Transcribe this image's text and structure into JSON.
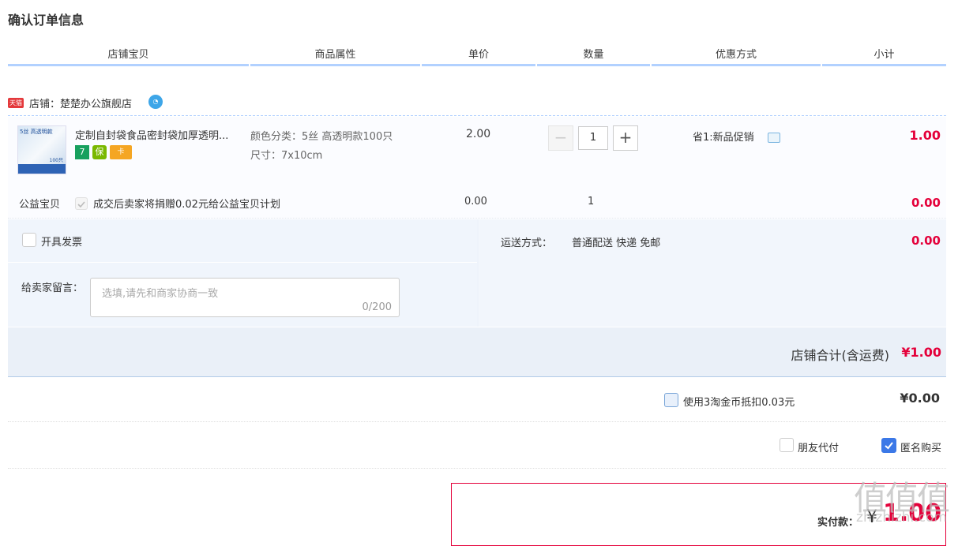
{
  "page_title": "确认订单信息",
  "columns": [
    "店铺宝贝",
    "商品属性",
    "单价",
    "数量",
    "优惠方式",
    "小计"
  ],
  "shop": {
    "badge_text": "天猫",
    "label": "店铺：楚楚办公旗舰店",
    "wangwang_icon": "wangwang-chat-icon"
  },
  "item": {
    "thumb_top_text": "5丝 高透明款",
    "thumb_count_text": "100只",
    "name": "定制自封袋食品密封袋加厚透明...",
    "service_badges": [
      "7",
      "保",
      "卡"
    ],
    "attr_color": "颜色分类：5丝 高透明款100只",
    "attr_size": "尺寸：7x10cm",
    "unit_price": "2.00",
    "quantity": "1",
    "minus": "−",
    "plus": "+",
    "promo": "省1:新品促销",
    "subtotal": "1.00"
  },
  "charity": {
    "label": "公益宝贝",
    "text": "成交后卖家将捐赠0.02元给公益宝贝计划",
    "price": "0.00",
    "quantity": "1",
    "subtotal": "0.00"
  },
  "options": {
    "invoice_label": "开具发票",
    "message_label": "给卖家留言：",
    "message_placeholder": "选填,请先和商家协商一致",
    "message_counter": "0/200",
    "shipping_label": "运送方式：",
    "shipping_value": "普通配送 快递 免邮",
    "shipping_fee": "0.00"
  },
  "shop_total": {
    "label": "店铺合计(含运费)",
    "value": "¥1.00"
  },
  "coins": {
    "label": "使用3淘金币抵扣0.03元",
    "value": "¥0.00"
  },
  "pay_options": {
    "friend_pay": "朋友代付",
    "anonymous": "匿名购买",
    "anonymous_checked": true
  },
  "payment": {
    "label": "实付款：",
    "currency": "¥",
    "value": "1.00"
  },
  "watermark": {
    "logo": "值值值",
    "url": "zhizhizhi.com"
  },
  "colors": {
    "accent_red": "#e4003a",
    "header_bar": "#b2d1ff",
    "checkbox_blue": "#3b78e7"
  }
}
